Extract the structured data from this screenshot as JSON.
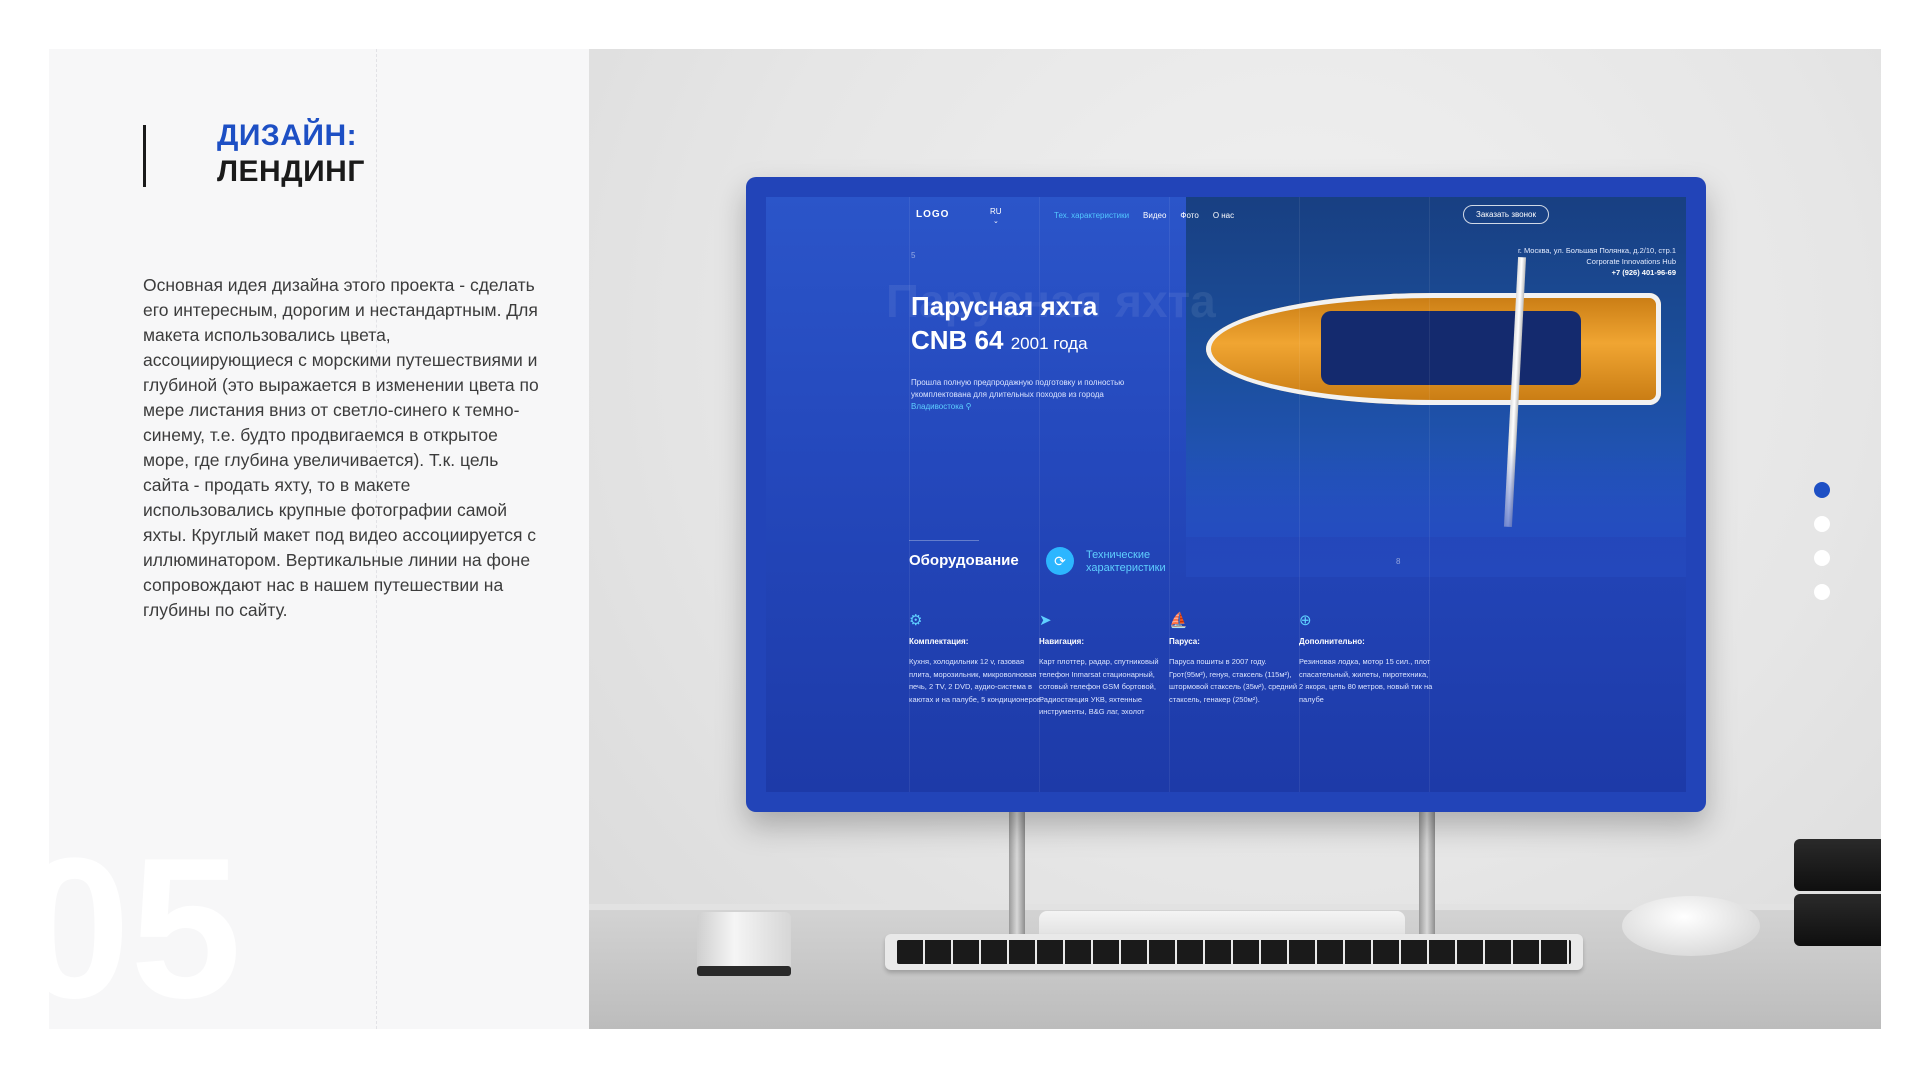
{
  "slide": {
    "title_line1": "ДИЗАЙН:",
    "title_line2": "ЛЕНДИНГ",
    "description": "Основная идея дизайна этого проекта - сделать его интересным, дорогим и нестандартным. Для макета использовались цвета, ассоциирующиеся с морскими путешествиями и глубиной (это выражается в изменении цвета по мере листания вниз от светло-синего к темно-синему, т.е. будто продвигаемся в открытое море, где глубина увеличивается). Т.к. цель сайта - продать яхту, то в макете использовались крупные фотографии самой яхты. Круглый макет под видео ассоциируется с иллюминатором. Вертикальные линии на фоне сопровождают нас в нашем путешествии на глубины по сайту.",
    "number": "05",
    "pager": {
      "count": 4,
      "active_index": 0
    },
    "colors": {
      "accent": "#1d4fc4",
      "screen_blue": "#2448bc",
      "highlight": "#52c7ff"
    }
  },
  "screen": {
    "nav": {
      "logo": "LOGO",
      "lang": "RU",
      "lang_icon": "chevron-down-icon",
      "links": [
        "Тех. характеристики",
        "Видео",
        "Фото",
        "О нас"
      ],
      "active_link": 0,
      "cta": "Заказать звонок"
    },
    "address": {
      "line1": "г. Москва, ул. Большая Полянка, д.2/10, стр.1",
      "line2": "Corporate Innovations Hub",
      "phone": "+7 (926) 401-96-69"
    },
    "hero": {
      "ghost_text": "Парусная яхта",
      "title_line1": "Парусная яхта",
      "title_line2": "CNB 64",
      "year": "2001 года",
      "desc_before_city": "Прошла полную предпродажную подготовку и полностью укомплектована для длительных походов из города",
      "city": "Владивостока",
      "city_icon": "location-pin-icon"
    },
    "markers": {
      "m1": "5",
      "m2": "8"
    },
    "section": {
      "title": "Оборудование",
      "toggle_icon": "refresh-icon",
      "alt_title": "Технические характеристики"
    },
    "features": [
      {
        "icon": "gear-icon",
        "glyph": "⚙",
        "title": "Комплектация:",
        "text": "Кухня, холодильник 12 v, газовая плита, морозильник, микроволновая печь, 2 TV, 2 DVD, аудио-система в каютах и на палубе, 5 кондиционеров."
      },
      {
        "icon": "navigation-icon",
        "glyph": "➤",
        "title": "Навигация:",
        "text": "Карт плоттер, радар, спутниковый телефон Inmarsat стационарный, сотовый телефон GSM бортовой, Радиостанция УКВ, яхтенные инструменты, B&G лаг, эхолот"
      },
      {
        "icon": "sailboat-icon",
        "glyph": "⛵",
        "title": "Паруса:",
        "text": "Паруса пошиты в 2007 году. Грот(95м²), генуя, стаксель (115м²), штормовой стаксель (35м²), средний стаксель, генакер (250м²)."
      },
      {
        "icon": "plus-circle-icon",
        "glyph": "⊕",
        "title": "Дополнительно:",
        "text": "Резиновая лодка, мотор 15 сил., плот спасательный, жилеты, пиротехника, 2 якоря, цепь 80 метров, новый тик на палубе"
      }
    ]
  }
}
